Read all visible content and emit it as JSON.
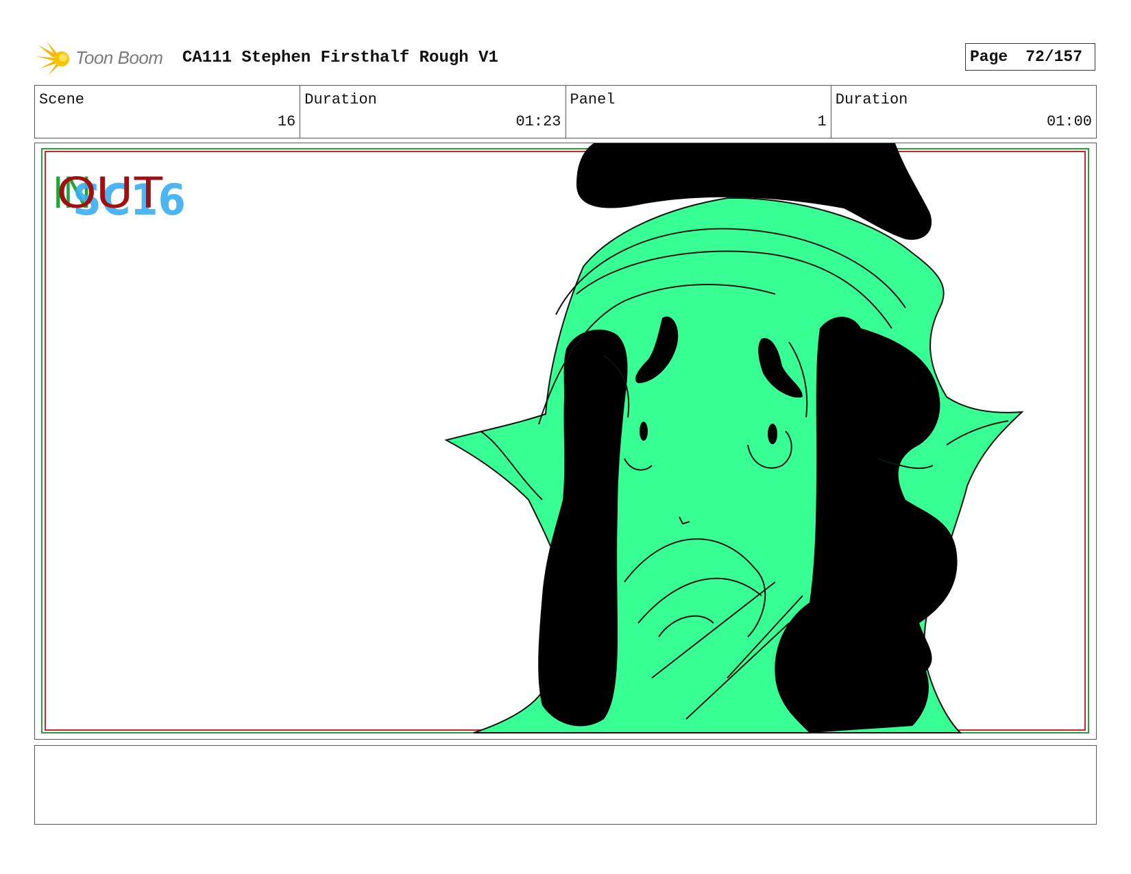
{
  "header": {
    "logo_text": "Toon Boom",
    "title": "CA111 Stephen Firsthalf Rough V1",
    "page_label": "Page",
    "page_value": "72/157"
  },
  "info": {
    "scene_label": "Scene",
    "scene_value": "16",
    "scene_duration_label": "Duration",
    "scene_duration_value": "01:23",
    "panel_label": "Panel",
    "panel_value": "1",
    "panel_duration_label": "Duration",
    "panel_duration_value": "01:00"
  },
  "panel": {
    "marker_in": "IN",
    "marker_out": "OUT",
    "sketch_note": "SC16",
    "colors": {
      "in_marker": "#1fa83a",
      "out_marker": "#a01010",
      "note": "#3aaef0",
      "fill": "#38ff93",
      "ink": "#000000",
      "safe_frame_red": "#c0282a",
      "safe_frame_green": "#2a9a3a"
    }
  },
  "caption": {
    "text": ""
  }
}
